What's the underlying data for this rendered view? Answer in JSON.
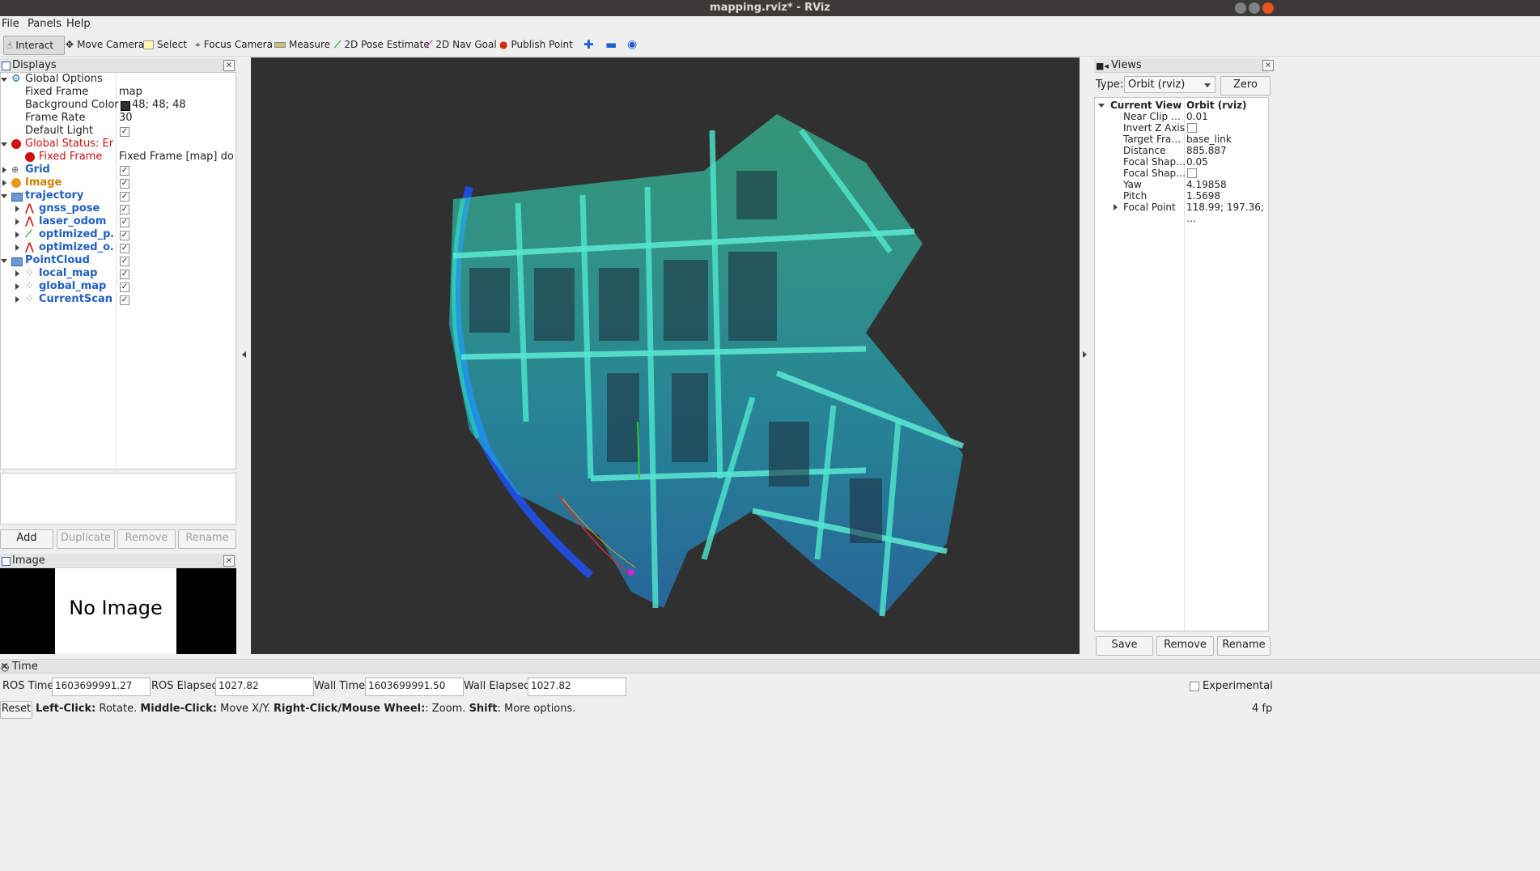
{
  "window": {
    "title": "mapping.rviz* - RViz"
  },
  "menu": [
    "File",
    "Panels",
    "Help"
  ],
  "toolbar": {
    "interact": "Interact",
    "move_camera": "Move Camera",
    "select": "Select",
    "focus_camera": "Focus Camera",
    "measure": "Measure",
    "pose_estimate": "2D Pose Estimate",
    "nav_goal": "2D Nav Goal",
    "publish_point": "Publish Point"
  },
  "displays": {
    "title": "Displays",
    "global_options": {
      "label": "Global Options",
      "fixed_frame_label": "Fixed Frame",
      "fixed_frame_value": "map",
      "bg_label": "Background Color",
      "bg_value": "48; 48; 48",
      "rate_label": "Frame Rate",
      "rate_value": "30",
      "light_label": "Default Light"
    },
    "global_status": {
      "label": "Global Status: Er…",
      "child_label": "Fixed Frame",
      "child_value": "Fixed Frame [map] doe…"
    },
    "items": {
      "grid": "Grid",
      "image": "Image",
      "trajectory": "trajectory",
      "gnss_pose": "gnss_pose",
      "laser_odom": "laser_odom",
      "optimized_p": "optimized_p…",
      "optimized_o": "optimized_o…",
      "pointcloud": "PointCloud",
      "local_map": "local_map",
      "global_map": "global_map",
      "current_scan": "CurrentScan"
    },
    "buttons": {
      "add": "Add",
      "duplicate": "Duplicate",
      "remove": "Remove",
      "rename": "Rename"
    }
  },
  "image_panel": {
    "title": "Image",
    "no_image": "No Image"
  },
  "views": {
    "title": "Views",
    "type_label": "Type:",
    "type_value": "Orbit (rviz)",
    "zero_button": "Zero",
    "current_view_label": "Current View",
    "current_view_value": "Orbit (rviz)",
    "props": [
      {
        "label": "Near Clip …",
        "value": "0.01"
      },
      {
        "label": "Invert Z Axis",
        "value": ""
      },
      {
        "label": "Target Fra…",
        "value": "base_link"
      },
      {
        "label": "Distance",
        "value": "885.887"
      },
      {
        "label": "Focal Shap…",
        "value": "0.05"
      },
      {
        "label": "Focal Shap…",
        "value": ""
      },
      {
        "label": "Yaw",
        "value": "4.19858"
      },
      {
        "label": "Pitch",
        "value": "1.5698"
      },
      {
        "label": "Focal Point",
        "value": "118.99; 197.36; …"
      }
    ],
    "buttons": {
      "save": "Save",
      "remove": "Remove",
      "rename": "Rename"
    }
  },
  "time": {
    "title": "Time",
    "ros_time_label": "ROS Time:",
    "ros_time": "1603699991.27",
    "ros_elapsed_label": "ROS Elapsed:",
    "ros_elapsed": "1027.82",
    "wall_time_label": "Wall Time:",
    "wall_time": "1603699991.50",
    "wall_elapsed_label": "Wall Elapsed:",
    "wall_elapsed": "1027.82",
    "experimental": "Experimental"
  },
  "status": {
    "reset": "Reset",
    "k1": "Left-Click:",
    "t1": " Rotate. ",
    "k2": "Middle-Click:",
    "t2": " Move X/Y. ",
    "k3": "Right-Click/Mouse Wheel:",
    "t3": ": Zoom. ",
    "k4": "Shift",
    "t4": ": More options.",
    "fps": "4 fp"
  },
  "colors": {
    "viewport_bg": "#303030",
    "titlebar": "#3c3b37",
    "close_button": "#e95420"
  }
}
